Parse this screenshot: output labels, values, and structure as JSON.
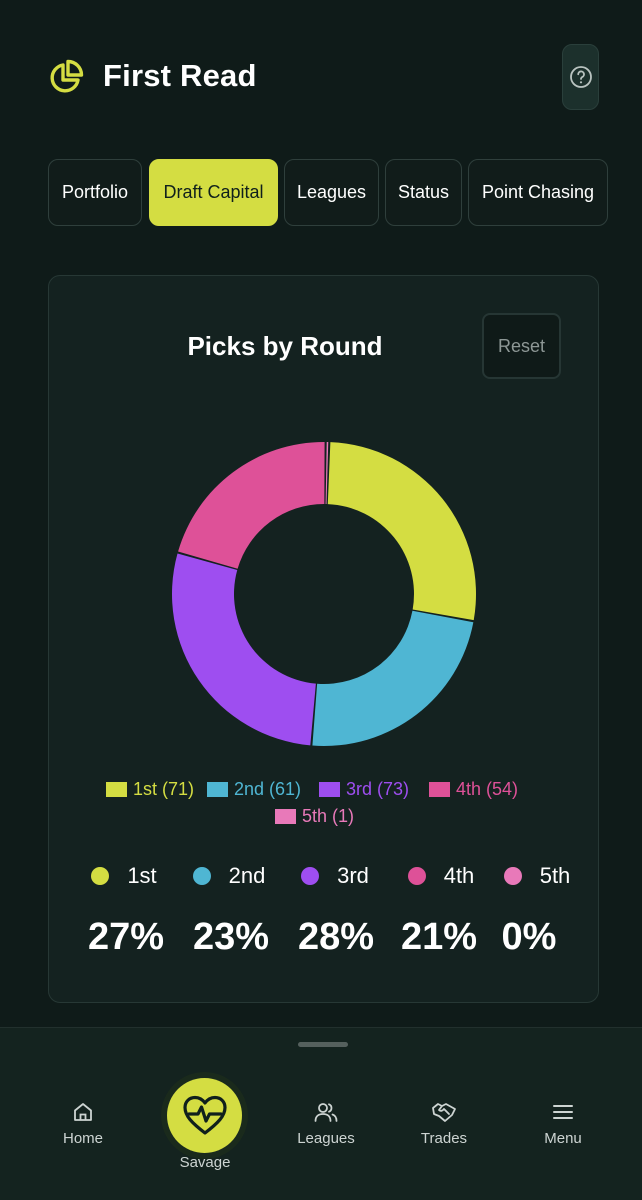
{
  "app": {
    "title": "First Read"
  },
  "colors": {
    "accent": "#d4dd42",
    "round1": "#d4dd42",
    "round2": "#4fb6d3",
    "round3": "#9e4ef0",
    "round4": "#de5198",
    "round5": "#e879b9"
  },
  "icons": {
    "logo": "pie-chart-icon",
    "help": "help-circle-icon"
  },
  "tabs": [
    {
      "label": "Portfolio",
      "active": false
    },
    {
      "label": "Draft Capital",
      "active": true
    },
    {
      "label": "Leagues",
      "active": false
    },
    {
      "label": "Status",
      "active": false
    },
    {
      "label": "Point Chasing",
      "active": false
    }
  ],
  "card": {
    "title": "Picks by Round",
    "reset_label": "Reset"
  },
  "chart_data": {
    "type": "pie",
    "variant": "donut",
    "title": "Picks by Round",
    "categories": [
      "1st",
      "2nd",
      "3rd",
      "4th",
      "5th"
    ],
    "values": [
      71,
      61,
      73,
      54,
      1
    ],
    "legend": [
      "1st (71)",
      "2nd (61)",
      "3rd (73)",
      "4th (54)",
      "5th (1)"
    ],
    "legend_placement": "bottom"
  },
  "stats": [
    {
      "label": "1st",
      "value": "27%"
    },
    {
      "label": "2nd",
      "value": "23%"
    },
    {
      "label": "3rd",
      "value": "28%"
    },
    {
      "label": "4th",
      "value": "21%"
    },
    {
      "label": "5th",
      "value": "0%"
    }
  ],
  "nav": {
    "home": "Home",
    "savage": "Savage",
    "leagues": "Leagues",
    "trades": "Trades",
    "menu": "Menu"
  }
}
